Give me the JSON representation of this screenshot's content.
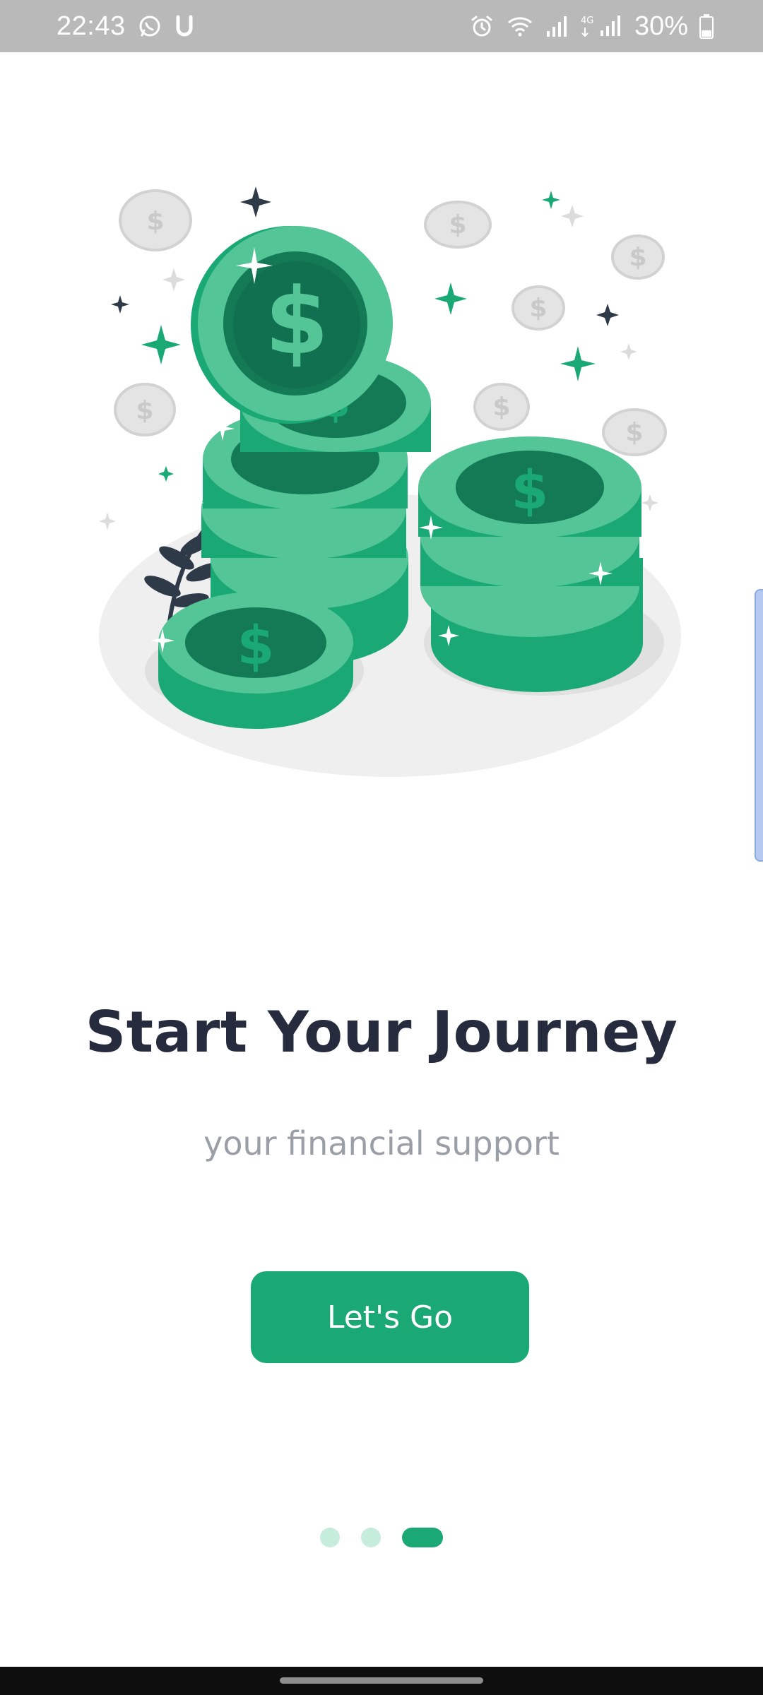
{
  "status_bar": {
    "time": "22:43",
    "left_icons": [
      "whatsapp-icon",
      "u-app-icon"
    ],
    "right_icons": [
      "alarm-icon",
      "wifi-icon",
      "signal-icon",
      "signal-4g-icon",
      "battery-icon"
    ],
    "network_label": "4G",
    "battery": "30%"
  },
  "illustration": {
    "name": "stack-of-green-dollar-coins",
    "colors": {
      "coin_green": "#1aa874",
      "coin_light": "#53c596",
      "coin_dark": "#137a55",
      "platform": "#efefef",
      "silver_coin": "#e4e4e4",
      "leaf": "#2e3a48"
    }
  },
  "onboarding": {
    "title": "Start Your Journey",
    "subtitle": "your financial support",
    "button_label": "Let's Go"
  },
  "pager": {
    "total": 3,
    "active_index": 2
  },
  "colors": {
    "accent": "#1aa874",
    "title": "#262c3e",
    "subtitle": "#9a9ea6",
    "status_bar": "#b9b9b9"
  }
}
